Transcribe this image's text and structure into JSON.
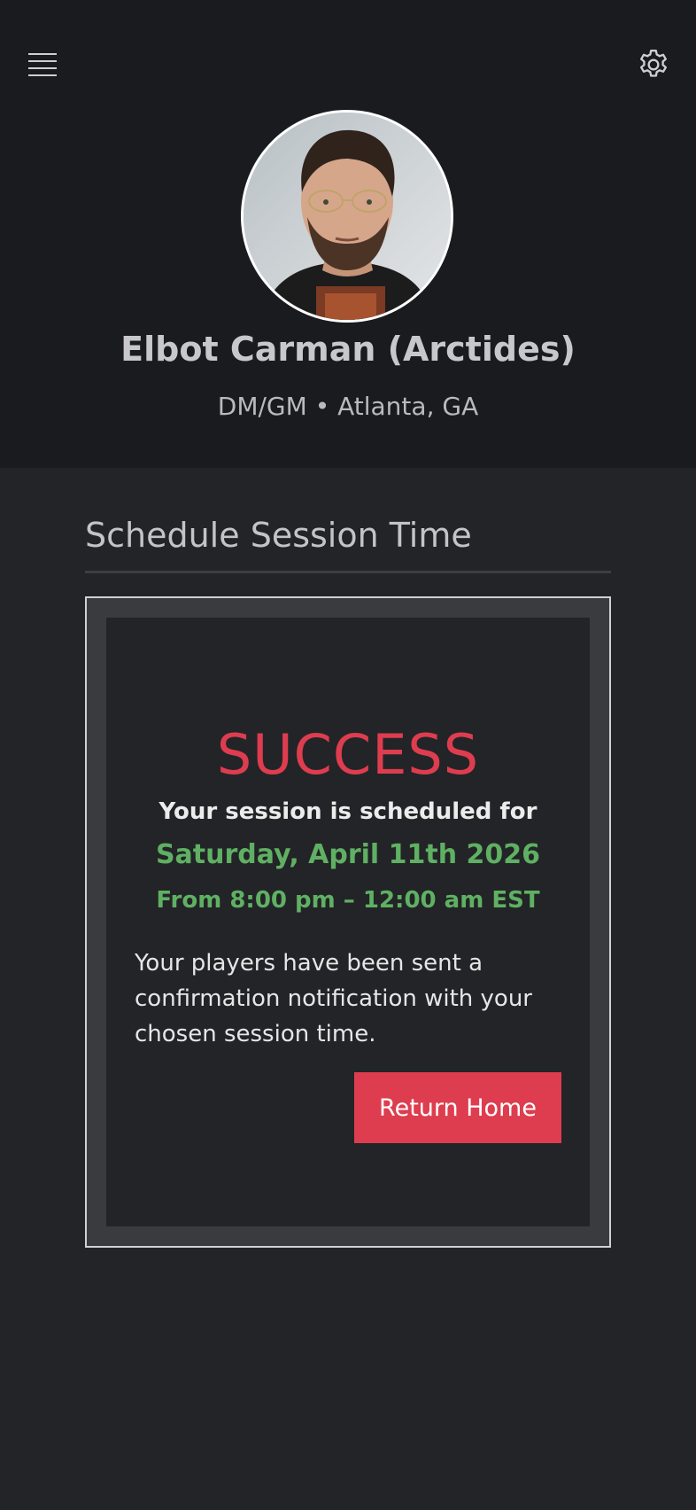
{
  "header": {
    "menu_icon": "hamburger-menu-icon",
    "settings_icon": "gear-icon",
    "profile": {
      "name": "Elbot Carman (Arctides)",
      "subtitle": "DM/GM • Atlanta, GA"
    }
  },
  "main": {
    "section_title": "Schedule Session Time",
    "card": {
      "heading": "SUCCESS",
      "scheduled_label": "Your session is scheduled for",
      "date": "Saturday, April 11th 2026",
      "time": "From 8:00 pm – 12:00 am EST",
      "message": "Your players have been sent a confirmation notification with your chosen session time.",
      "button_label": "Return Home"
    }
  },
  "colors": {
    "accent_red": "#de3d4f",
    "success_green": "#5fb063",
    "header_bg": "#1a1b1e",
    "body_bg": "#232427"
  }
}
